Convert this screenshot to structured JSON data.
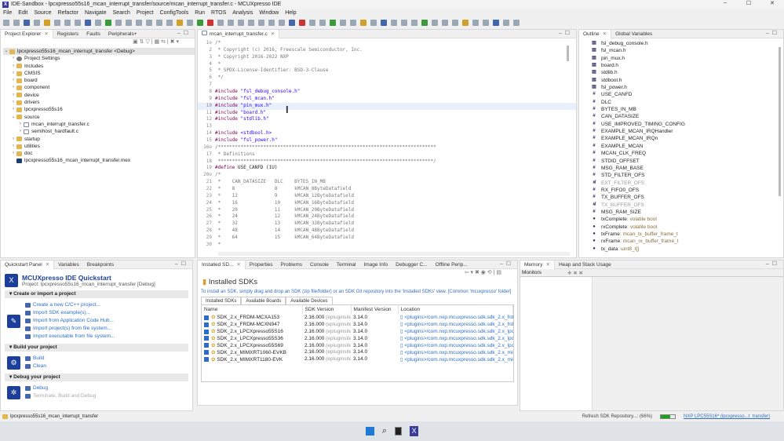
{
  "window": {
    "title": "IDE-Sandbox - lpcxpresso55s16_mcan_interrupt_transfer/source/mcan_interrupt_transfer.c - MCUXpresso IDE"
  },
  "menu": [
    "File",
    "Edit",
    "Source",
    "Refactor",
    "Navigate",
    "Search",
    "Project",
    "ConfigTools",
    "Run",
    "RTOS",
    "Analysis",
    "Window",
    "Help"
  ],
  "left_tabs": [
    "Project Explorer",
    "Registers",
    "Faults",
    "Peripherals+"
  ],
  "project_tree": [
    {
      "label": "lpcxpresso55s16_mcan_interrupt_transfer <Debug>",
      "level": 0,
      "icon": "project",
      "arrow": "v"
    },
    {
      "label": "Project Settings",
      "level": 1,
      "icon": "gear",
      "arrow": ">"
    },
    {
      "label": "Includes",
      "level": 1,
      "icon": "folder",
      "arrow": ">"
    },
    {
      "label": "CMSIS",
      "level": 1,
      "icon": "folder",
      "arrow": ">"
    },
    {
      "label": "board",
      "level": 1,
      "icon": "folder",
      "arrow": ">"
    },
    {
      "label": "component",
      "level": 1,
      "icon": "folder",
      "arrow": ">"
    },
    {
      "label": "device",
      "level": 1,
      "icon": "folder",
      "arrow": ">"
    },
    {
      "label": "drivers",
      "level": 1,
      "icon": "folder",
      "arrow": ">"
    },
    {
      "label": "lpcxpresso55s16",
      "level": 1,
      "icon": "folder",
      "arrow": ">"
    },
    {
      "label": "source",
      "level": 1,
      "icon": "folder",
      "arrow": "v"
    },
    {
      "label": "mcan_interrupt_transfer.c",
      "level": 2,
      "icon": "file",
      "arrow": ">"
    },
    {
      "label": "semihost_hardfault.c",
      "level": 2,
      "icon": "file",
      "arrow": ">"
    },
    {
      "label": "startup",
      "level": 1,
      "icon": "folder",
      "arrow": ">"
    },
    {
      "label": "utilities",
      "level": 1,
      "icon": "folder",
      "arrow": ">"
    },
    {
      "label": "doc",
      "level": 1,
      "icon": "folder",
      "arrow": ">"
    },
    {
      "label": "lpcxpresso55s16_mcan_interrupt_transfer.mex",
      "level": 1,
      "icon": "mex",
      "arrow": ""
    }
  ],
  "editor": {
    "tab": "mcan_interrupt_transfer.c",
    "lines": [
      {
        "n": "1⊖",
        "t": "/*",
        "c": "cm"
      },
      {
        "n": "2",
        "t": " * Copyright (c) 2016, Freescale Semiconductor, Inc.",
        "c": "cm"
      },
      {
        "n": "3",
        "t": " * Copyright 2016-2022 NXP",
        "c": "cm"
      },
      {
        "n": "4",
        "t": " *",
        "c": "cm"
      },
      {
        "n": "5",
        "t": " * SPDX-License-Identifier: BSD-3-Clause",
        "c": "cm"
      },
      {
        "n": "6",
        "t": " */",
        "c": "cm"
      },
      {
        "n": "7",
        "t": "",
        "c": ""
      },
      {
        "n": "8",
        "k": "#include ",
        "t": "\"fsl_debug_console.h\"",
        "c": "st"
      },
      {
        "n": "9",
        "k": "#include ",
        "t": "\"fsl_mcan.h\"",
        "c": "st"
      },
      {
        "n": "10",
        "k": "#include ",
        "t": "\"pin_mux.h\"",
        "c": "st",
        "hl": true
      },
      {
        "n": "11",
        "k": "#include ",
        "t": "\"board.h\"",
        "c": "st"
      },
      {
        "n": "12",
        "k": "#include ",
        "t": "\"stdlib.h\"",
        "c": "st"
      },
      {
        "n": "13",
        "t": "",
        "c": ""
      },
      {
        "n": "14",
        "k": "#include ",
        "t": "<stdbool.h>",
        "c": "st"
      },
      {
        "n": "15",
        "k": "#include ",
        "t": "\"fsl_power.h\"",
        "c": "st"
      },
      {
        "n": "16⊖",
        "t": "/*****************************************************************************",
        "c": "cm"
      },
      {
        "n": "17",
        "t": " * Definitions",
        "c": "cm"
      },
      {
        "n": "18",
        "t": " ****************************************************************************/",
        "c": "cm"
      },
      {
        "n": "19",
        "k": "#define ",
        "t": "USE_CANFD (1U)",
        "c": ""
      },
      {
        "n": "20⊖",
        "t": "/*",
        "c": "cm"
      },
      {
        "n": "21",
        "t": " *    CAN_DATASIZE   DLC    BYTES_IN_MB",
        "c": "cm"
      },
      {
        "n": "22",
        "t": " *    8              8      kMCAN_8ByteDatafield",
        "c": "cm"
      },
      {
        "n": "23",
        "t": " *    12             9      kMCAN_12ByteDatafield",
        "c": "cm"
      },
      {
        "n": "24",
        "t": " *    16             10     kMCAN_16ByteDatafield",
        "c": "cm"
      },
      {
        "n": "25",
        "t": " *    20             11     kMCAN_20ByteDatafield",
        "c": "cm"
      },
      {
        "n": "26",
        "t": " *    24             12     kMCAN_24ByteDatafield",
        "c": "cm"
      },
      {
        "n": "27",
        "t": " *    32             13     kMCAN_32ByteDatafield",
        "c": "cm"
      },
      {
        "n": "28",
        "t": " *    48             14     kMCAN_48ByteDatafield",
        "c": "cm"
      },
      {
        "n": "29",
        "t": " *    64             15     kMCAN_64ByteDatafield",
        "c": "cm"
      },
      {
        "n": "30",
        "t": " *",
        "c": "cm"
      }
    ]
  },
  "outline": {
    "tabs": [
      "Outline",
      "Global Variables"
    ],
    "items": [
      {
        "i": "inc",
        "label": "fsl_debug_console.h"
      },
      {
        "i": "inc",
        "label": "fsl_mcan.h"
      },
      {
        "i": "inc",
        "label": "pin_mux.h"
      },
      {
        "i": "inc",
        "label": "board.h"
      },
      {
        "i": "inc",
        "label": "stdlib.h"
      },
      {
        "i": "inc",
        "label": "stdbool.h"
      },
      {
        "i": "inc",
        "label": "fsl_power.h"
      },
      {
        "i": "def",
        "label": "USE_CANFD"
      },
      {
        "i": "def",
        "label": "DLC"
      },
      {
        "i": "def",
        "label": "BYTES_IN_MB"
      },
      {
        "i": "def",
        "label": "CAN_DATASIZE"
      },
      {
        "i": "def",
        "label": "USE_IMPROVED_TIMING_CONFIG"
      },
      {
        "i": "def",
        "label": "EXAMPLE_MCAN_IRQHandler"
      },
      {
        "i": "def",
        "label": "EXAMPLE_MCAN_IRQn"
      },
      {
        "i": "def",
        "label": "EXAMPLE_MCAN"
      },
      {
        "i": "def",
        "label": "MCAN_CLK_FREQ"
      },
      {
        "i": "def",
        "label": "STDID_OFFSET"
      },
      {
        "i": "def",
        "label": "MSG_RAM_BASE"
      },
      {
        "i": "def",
        "label": "STD_FILTER_OFS"
      },
      {
        "i": "undef",
        "label": "EXT_FILTER_OFS",
        "dim": true
      },
      {
        "i": "def",
        "label": "RX_FIFO0_OFS"
      },
      {
        "i": "def",
        "label": "TX_BUFFER_OFS"
      },
      {
        "i": "undef",
        "label": "TX_BUFFER_OFS",
        "dim": true
      },
      {
        "i": "def",
        "label": "MSG_RAM_SIZE"
      },
      {
        "i": "var",
        "label": "txComplete",
        "type": " : volatile bool"
      },
      {
        "i": "var",
        "label": "rxComplete",
        "type": " : volatile bool"
      },
      {
        "i": "var",
        "label": "txFrame",
        "type": " : mcan_tx_buffer_frame_t"
      },
      {
        "i": "var",
        "label": "rxFrame",
        "type": " : mcan_rx_buffer_frame_t"
      },
      {
        "i": "var",
        "label": "tx_data",
        "type": " : uint8_t[]"
      }
    ]
  },
  "quickstart": {
    "tabs": [
      "Quickstart Panel",
      "Variables",
      "Breakpoints"
    ],
    "title": "MCUXpresso IDE Quickstart",
    "project": "Project: lpcxpresso55s16_mcan_interrupt_transfer [Debug]",
    "sections": [
      {
        "title": "Create or import a project",
        "links": [
          {
            "label": "Create a new C/C++ project..."
          },
          {
            "label": "Import SDK example(s)..."
          },
          {
            "label": "Import from Application Code Hub..."
          },
          {
            "label": "Import project(s) from file system..."
          },
          {
            "label": "Import executable from file system..."
          }
        ]
      },
      {
        "title": "Build your project",
        "links": [
          {
            "label": "Build"
          },
          {
            "label": "Clean"
          }
        ]
      },
      {
        "title": "Debug your project",
        "links": [
          {
            "label": "Debug"
          },
          {
            "label": "Terminate, Build and Debug",
            "dim": true
          }
        ]
      }
    ]
  },
  "sdk": {
    "tabs": [
      "Installed SD...",
      "Properties",
      "Problems",
      "Console",
      "Terminal",
      "Image Info",
      "Debugger C...",
      "Offline Perip..."
    ],
    "title": "Installed SDKs",
    "hint": "To install an SDK, simply drag and drop an SDK (zip file/folder) or an SDK Git repository into the 'Installed SDKs' view. [Common 'mcuxpresso' folder]",
    "subtabs": [
      "Installed SDKs",
      "Available Boards",
      "Available Devices"
    ],
    "columns": [
      "Name",
      "SDK Version",
      "Manifest Version",
      "Location"
    ],
    "rows": [
      {
        "name": "SDK_2.x_FRDM-MCXA153",
        "ver": "2.16.000",
        "site": "(epluginsite8",
        "man": "3.14.0",
        "loc": "<plugins>/com.nxp.mcuxpresso.sdk.sdk_2.x_frdm-r"
      },
      {
        "name": "SDK_2.x_FRDM-MCXN947",
        "ver": "2.16.000",
        "site": "(epluginsite8",
        "man": "3.14.0",
        "loc": "<plugins>/com.nxp.mcuxpresso.sdk.sdk_2.x_frdm-r"
      },
      {
        "name": "SDK_2.x_LPCXpresso55S16",
        "ver": "2.16.000",
        "site": "(epluginsite8",
        "man": "3.14.0",
        "loc": "<plugins>/com.nxp.mcuxpresso.sdk.sdk_2.x_lpcxpr"
      },
      {
        "name": "SDK_2.x_LPCXpresso55S36",
        "ver": "2.16.000",
        "site": "(epluginsite8",
        "man": "3.14.0",
        "loc": "<plugins>/com.nxp.mcuxpresso.sdk.sdk_2.x_lpcxpr"
      },
      {
        "name": "SDK_2.x_LPCXpresso55S69",
        "ver": "2.16.000",
        "site": "(epluginsite8",
        "man": "3.14.0",
        "loc": "<plugins>/com.nxp.mcuxpresso.sdk.sdk_2.x_lpcxpr"
      },
      {
        "name": "SDK_2.x_MIMXRT1060-EVKB",
        "ver": "2.16.000",
        "site": "(epluginsite8",
        "man": "3.14.0",
        "loc": "<plugins>/com.nxp.mcuxpresso.sdk.sdk_2.x_mimxr"
      },
      {
        "name": "SDK_2.x_MIMXRT1180-EVK",
        "ver": "2.16.000",
        "site": "(epluginsite8",
        "man": "3.14.0",
        "loc": "<plugins>/com.nxp.mcuxpresso.sdk.sdk_2.x_mimxr"
      }
    ]
  },
  "memory": {
    "tabs": [
      "Memory",
      "Heap and Stack Usage"
    ],
    "monitors": "Monitors"
  },
  "status": {
    "project": "lpcxpresso55s16_mcan_interrupt_transfer",
    "task": "Refresh SDK Repository...: (66%)",
    "progress": 66,
    "debug": "NXP LPC55S16* (lpcxpresso...t_transfer)"
  },
  "colors": {
    "accent": "#2f6fc3",
    "brand": "#1b3f9b"
  }
}
